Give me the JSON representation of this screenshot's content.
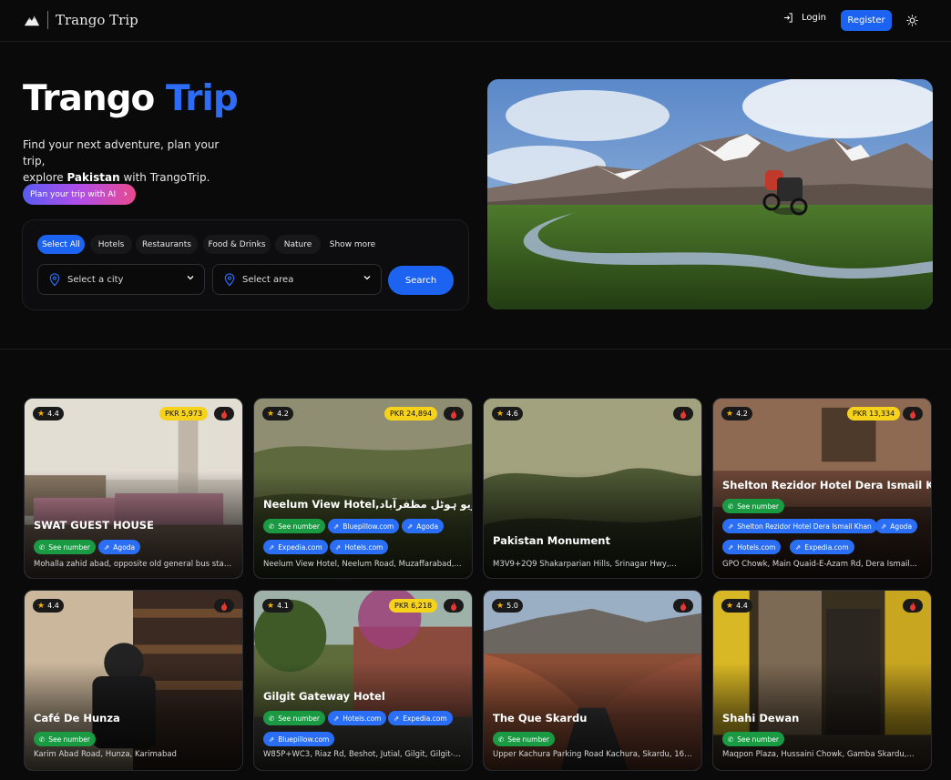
{
  "header": {
    "brand": "Trango Trip",
    "login_label": "Login",
    "register_label": "Register"
  },
  "hero": {
    "title_part1": "Trango",
    "title_part2": "Trip",
    "subtitle_line1": "Find your next adventure, plan your trip,",
    "subtitle_pre": "explore ",
    "subtitle_bold": "Pakistan",
    "subtitle_post": " with TrangoTrip.",
    "ai_button": "Plan your trip with AI"
  },
  "search": {
    "chips": [
      "Select All",
      "Hotels",
      "Restaurants",
      "Food & Drinks",
      "Nature",
      "Show more"
    ],
    "city_placeholder": "Select a city",
    "area_placeholder": "Select area",
    "search_label": "Search"
  },
  "cards": [
    {
      "rating": "4.4",
      "price": "PKR 5,973",
      "title": "SWAT GUEST HOUSE",
      "tags": [
        "See number",
        "Agoda"
      ],
      "address": "Mohalla zahid abad, opposite old general bus stand..."
    },
    {
      "rating": "4.2",
      "price": "PKR 24,894",
      "title": "Neelum View Hotel,نیلم ویو ہوٹل مظفرآباد",
      "tags": [
        "See number",
        "Bluepillow.com",
        "Agoda",
        "Expedia.com",
        "Hotels.com"
      ],
      "address": "Neelum View Hotel, Neelum Road, Muzaffarabad,..."
    },
    {
      "rating": "4.6",
      "price": "",
      "title": "Pakistan Monument",
      "tags": [],
      "address": "M3V9+2Q9 Shakarparian Hills, Srinagar Hwy,..."
    },
    {
      "rating": "4.2",
      "price": "PKR 13,334",
      "title": "Shelton Rezidor Hotel Dera Ismail Khan",
      "tags": [
        "See number",
        "Shelton Rezidor Hotel Dera Ismail Khan",
        "Agoda",
        "Hotels.com",
        "Expedia.com"
      ],
      "address": "GPO Chowk, Main Quaid-E-Azam Rd, Dera Ismail..."
    },
    {
      "rating": "4.4",
      "price": "",
      "title": "Café De Hunza",
      "tags": [
        "See number"
      ],
      "address": "Karim Abad Road, Hunza, Karimabad"
    },
    {
      "rating": "4.1",
      "price": "PKR 6,218",
      "title": "Gilgit Gateway Hotel",
      "tags": [
        "See number",
        "Hotels.com",
        "Expedia.com",
        "Bluepillow.com"
      ],
      "address": "W85P+WC3, Riaz Rd, Beshot, Jutial, Gilgit, Gilgit-..."
    },
    {
      "rating": "5.0",
      "price": "",
      "title": "The Que Skardu",
      "tags": [
        "See number"
      ],
      "address": "Upper Kachura Parking Road Kachura, Skardu, 16150"
    },
    {
      "rating": "4.4",
      "price": "",
      "title": "Shahi Dewan",
      "tags": [
        "See number"
      ],
      "address": "Maqpon Plaza, Hussaini Chowk, Gamba Skardu,..."
    }
  ],
  "colors": {
    "accent": "#1d63f2",
    "price_badge": "#f7d21b",
    "number_tag": "#1a9a43",
    "link_tag": "#2a6ef5"
  }
}
